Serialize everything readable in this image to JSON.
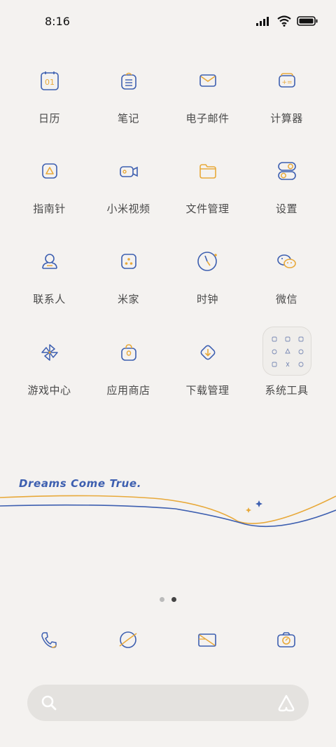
{
  "status": {
    "time": "8:16"
  },
  "apps": [
    {
      "label": "日历",
      "icon": "calendar-icon",
      "calendar_day": "01"
    },
    {
      "label": "笔记",
      "icon": "notes-icon"
    },
    {
      "label": "电子邮件",
      "icon": "mail-icon"
    },
    {
      "label": "计算器",
      "icon": "calculator-icon"
    },
    {
      "label": "指南针",
      "icon": "compass-icon"
    },
    {
      "label": "小米视频",
      "icon": "video-icon"
    },
    {
      "label": "文件管理",
      "icon": "folder-icon"
    },
    {
      "label": "设置",
      "icon": "settings-toggle-icon"
    },
    {
      "label": "联系人",
      "icon": "contact-icon"
    },
    {
      "label": "米家",
      "icon": "mijia-icon"
    },
    {
      "label": "时钟",
      "icon": "clock-icon"
    },
    {
      "label": "微信",
      "icon": "wechat-icon"
    },
    {
      "label": "游戏中心",
      "icon": "pinwheel-icon"
    },
    {
      "label": "应用商店",
      "icon": "store-bag-icon"
    },
    {
      "label": "下载管理",
      "icon": "download-icon"
    },
    {
      "label": "系统工具",
      "icon": "folder-grid-icon"
    }
  ],
  "banner": {
    "text": "Dreams Come True."
  },
  "page_indicator": {
    "count": 2,
    "active": 1
  },
  "dock": [
    {
      "icon": "phone-icon"
    },
    {
      "icon": "browser-icon"
    },
    {
      "icon": "messages-icon"
    },
    {
      "icon": "camera-icon"
    }
  ],
  "search": {
    "icon": "search-icon",
    "right_icon": "assistant-icon"
  },
  "colors": {
    "blue": "#3d5fb0",
    "orange": "#e8a93a",
    "background": "#f4f2f0"
  }
}
